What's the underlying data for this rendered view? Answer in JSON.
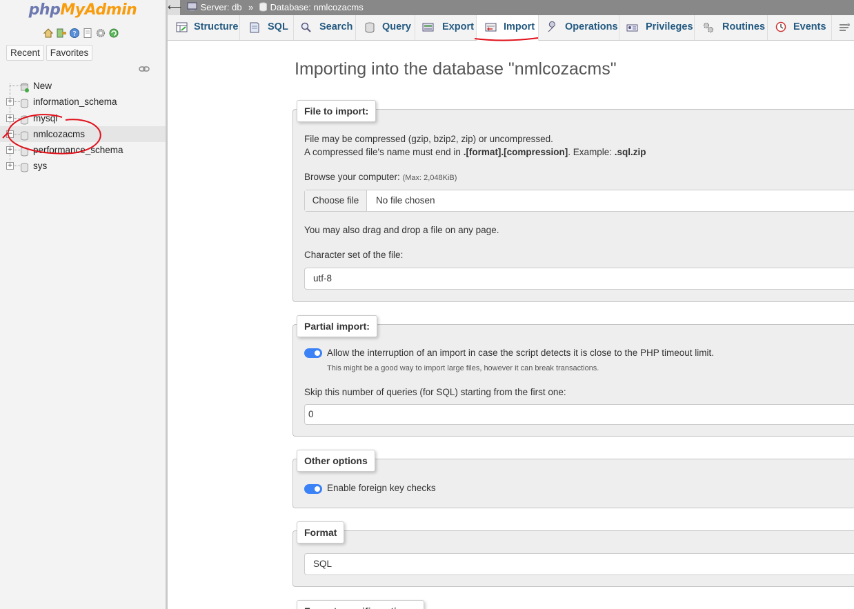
{
  "sidebar": {
    "logo_php": "php",
    "logo_myadmin": "MyAdmin",
    "quick_icons": [
      "home-icon",
      "logout-icon",
      "help-icon",
      "docs-icon",
      "settings-icon",
      "reload-icon"
    ],
    "tabs": {
      "recent": "Recent",
      "favorites": "Favorites"
    },
    "tree": [
      {
        "label": "New",
        "icon": "new-db-icon"
      },
      {
        "label": "information_schema",
        "icon": "database-icon"
      },
      {
        "label": "mysql",
        "icon": "database-icon"
      },
      {
        "label": "nmlcozacms",
        "icon": "database-icon",
        "selected": true
      },
      {
        "label": "performance_schema",
        "icon": "database-icon"
      },
      {
        "label": "sys",
        "icon": "database-icon"
      }
    ]
  },
  "breadcrumb": {
    "server": "Server: db",
    "separator": "»",
    "database": "Database: nmlcozacms"
  },
  "tabs": [
    {
      "label": "Structure",
      "icon": "structure-icon"
    },
    {
      "label": "SQL",
      "icon": "sql-icon"
    },
    {
      "label": "Search",
      "icon": "search-icon"
    },
    {
      "label": "Query",
      "icon": "query-icon"
    },
    {
      "label": "Export",
      "icon": "export-icon"
    },
    {
      "label": "Import",
      "icon": "import-icon",
      "active": true
    },
    {
      "label": "Operations",
      "icon": "wrench-icon"
    },
    {
      "label": "Privileges",
      "icon": "privileges-icon"
    },
    {
      "label": "Routines",
      "icon": "routines-icon"
    },
    {
      "label": "Events",
      "icon": "events-icon"
    },
    {
      "label": "",
      "icon": "triggers-icon"
    }
  ],
  "main": {
    "title": "Importing into the database \"nmlcozacms\"",
    "file_import": {
      "legend": "File to import:",
      "line1": "File may be compressed (gzip, bzip2, zip) or uncompressed.",
      "line2_prefix": "A compressed file's name must end in ",
      "line2_format": ".[format].[compression]",
      "line2_mid": ". Example: ",
      "line2_example": ".sql.zip",
      "browse_label": "Browse your computer: ",
      "browse_max": "(Max: 2,048KiB)",
      "choose_file_button": "Choose file",
      "no_file": "No file chosen",
      "drag_drop": "You may also drag and drop a file on any page.",
      "charset_label": "Character set of the file:",
      "charset_value": "utf-8"
    },
    "partial_import": {
      "legend": "Partial import:",
      "allow_interrupt": "Allow the interruption of an import in case the script detects it is close to the PHP timeout limit.",
      "allow_interrupt_note": "This might be a good way to import large files, however it can break transactions.",
      "allow_interrupt_on": true,
      "skip_label": "Skip this number of queries (for SQL) starting from the first one:",
      "skip_value": "0"
    },
    "other_options": {
      "legend": "Other options",
      "foreign_keys": "Enable foreign key checks",
      "foreign_keys_on": true
    },
    "format": {
      "legend": "Format",
      "value": "SQL"
    },
    "format_specific": {
      "legend": "Format-specific options:"
    }
  },
  "colors": {
    "tab_text": "#235a81",
    "toggle_on": "#3b82f6",
    "annotation": "#e0101a"
  }
}
